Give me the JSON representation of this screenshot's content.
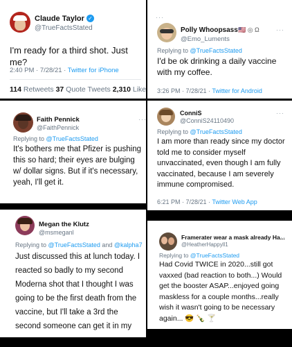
{
  "tweets": [
    {
      "name": "Claude Taylor",
      "handle": "@TrueFactsStated",
      "text": "I'm ready for a third shot. Just me?",
      "time": "2:40 PM · 7/28/21 · ",
      "client": "Twitter for iPhone",
      "stats": {
        "retweets_num": "114",
        "retweets_label": " Retweets ",
        "quotes_num": "37",
        "quotes_label": " Quote Tweets ",
        "likes_num": "2,310",
        "likes_label": " Likes"
      },
      "verified_color": "#1d9bf0"
    },
    {
      "name": "Polly Whoopsass",
      "name_suffix": "🇺🇸 ◎ Ω",
      "handle": "@Emo_Luments",
      "reply_prefix": "Replying to ",
      "reply_to": "@TrueFactsStated",
      "text": "I'd be ok drinking a daily vaccine with my coffee.",
      "time": "3:26 PM · 7/28/21 · ",
      "client": "Twitter for Android"
    },
    {
      "name": "Faith Pennick",
      "handle": "@FaithPennick",
      "reply_prefix": "Replying to ",
      "reply_to": "@TrueFactsStated",
      "text": "It's bothers me that Pfizer is pushing this so hard; their eyes are bulging w/ dollar signs. But if it's necessary, yeah, I'll get it."
    },
    {
      "name": "ConniS",
      "handle": "@ConniS24110490",
      "reply_prefix": "Replying to ",
      "reply_to": "@TrueFactsStated",
      "text": "I am more than ready since my doctor told me to consider myself unvaccinated, even though I am fully vaccinated, because I am severely immune compromised.",
      "time": "6:21 PM · 7/28/21 · ",
      "client": "Twitter Web App"
    },
    {
      "name": "Megan the Klutz",
      "handle": "@msmeganl",
      "reply_prefix": "Replying to ",
      "reply_to": "@TrueFactsStated",
      "reply_and": " and ",
      "reply_to2": "@kalpha7",
      "text": "Just discussed this at lunch today. I reacted so badly to my second Moderna shot that I thought I was going to be the first death from the vaccine, but I'll take a 3rd the second someone can get it in my arm."
    },
    {
      "name": "Framerater wear a mask already Ha...",
      "handle": "@HeatherHappyll1",
      "reply_prefix": "Replying to ",
      "reply_to": "@TrueFactsStated",
      "text": "Had Covid TWICE in 2020...still got vaxxed (bad reaction to both...) Would get the booster ASAP...enjoyed going maskless for a couple months...really wish it wasn't going to be necessary again... 😎 🍾 🍸"
    }
  ],
  "more_glyph": "···"
}
